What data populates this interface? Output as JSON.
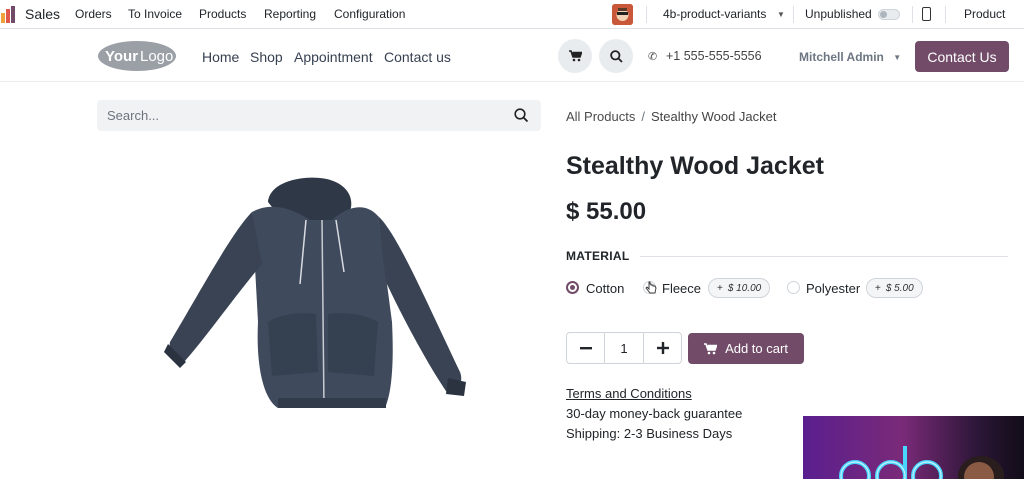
{
  "topbar": {
    "app_name": "Sales",
    "menu": [
      "Orders",
      "To Invoice",
      "Products",
      "Reporting",
      "Configuration"
    ],
    "website_selector": "4b-product-variants",
    "publish_status": "Unpublished",
    "edit_label": "Product"
  },
  "nav": {
    "logo_text": "YourLogo",
    "links": [
      "Home",
      "Shop",
      "Appointment",
      "Contact us"
    ],
    "phone": "+1 555-555-5556",
    "user": "Mitchell Admin",
    "cta": "Contact Us"
  },
  "search": {
    "placeholder": "Search..."
  },
  "breadcrumb": {
    "parent": "All Products",
    "separator": "/",
    "current": "Stealthy Wood Jacket"
  },
  "product": {
    "name": "Stealthy Wood Jacket",
    "price": "$ 55.00",
    "attribute": {
      "label": "MATERIAL",
      "options": [
        {
          "label": "Cotton",
          "selected": true,
          "extra": ""
        },
        {
          "label": "Fleece",
          "selected": false,
          "extra": "$ 10.00"
        },
        {
          "label": "Polyester",
          "selected": false,
          "extra": "$ 5.00"
        }
      ],
      "extra_prefix": "+"
    },
    "quantity": "1",
    "add_to_cart": "Add to cart",
    "terms": "Terms and Conditions",
    "guarantee": "30-day money-back guarantee",
    "shipping": "Shipping: 2-3 Business Days"
  },
  "colors": {
    "brand": "#714b67",
    "jacket": "#3f4a5c"
  }
}
